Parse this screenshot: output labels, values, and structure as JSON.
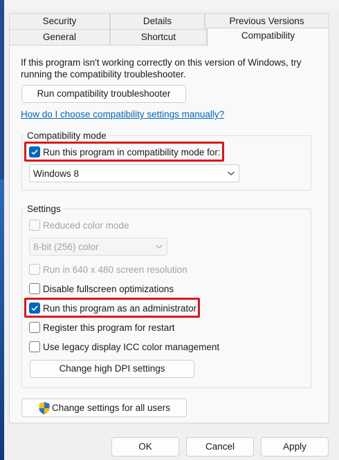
{
  "tabs": {
    "row1": [
      "Security",
      "Details",
      "Previous Versions"
    ],
    "row2": [
      "General",
      "Shortcut",
      "Compatibility"
    ],
    "active": "Compatibility"
  },
  "intro_text": "If this program isn't working correctly on this version of Windows, try running the compatibility troubleshooter.",
  "troubleshooter_button": "Run compatibility troubleshooter",
  "help_link": "How do I choose compatibility settings manually?",
  "compat_mode": {
    "title": "Compatibility mode",
    "checkbox_label": "Run this program in compatibility mode for:",
    "checked": true,
    "selected_os": "Windows 8"
  },
  "settings": {
    "title": "Settings",
    "reduced_color": {
      "label": "Reduced color mode",
      "checked": false,
      "disabled": true
    },
    "color_select": "8-bit (256) color",
    "run_640": {
      "label": "Run in 640 x 480 screen resolution",
      "checked": false,
      "disabled": true
    },
    "disable_fullscreen": {
      "label": "Disable fullscreen optimizations",
      "checked": false
    },
    "run_admin": {
      "label": "Run this program as an administrator",
      "checked": true
    },
    "register_restart": {
      "label": "Register this program for restart",
      "checked": false
    },
    "legacy_icc": {
      "label": "Use legacy display ICC color management",
      "checked": false
    },
    "dpi_button": "Change high DPI settings"
  },
  "all_users_button": "Change settings for all users",
  "footer": {
    "ok": "OK",
    "cancel": "Cancel",
    "apply": "Apply"
  },
  "colors": {
    "accent": "#0067c0",
    "highlight": "#e0141a",
    "link": "#0067c0"
  }
}
